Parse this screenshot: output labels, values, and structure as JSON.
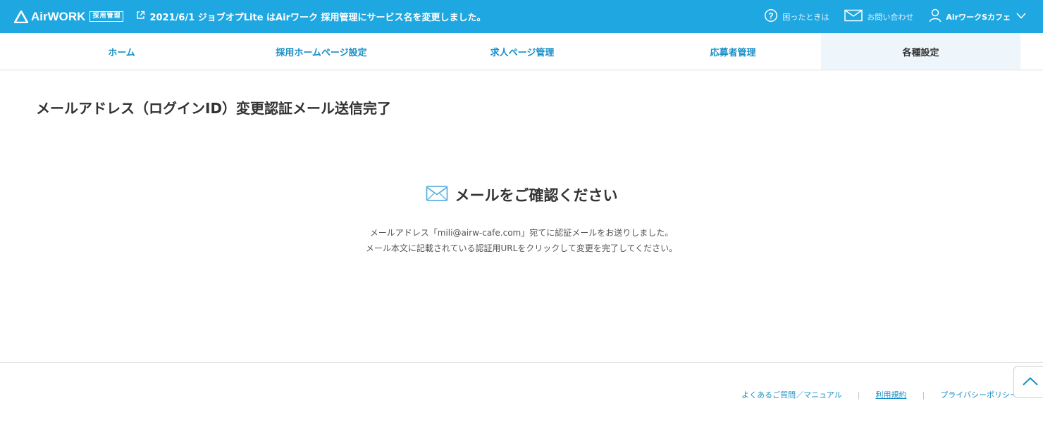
{
  "header": {
    "logo_text": "AirWORK",
    "logo_badge": "採用管理",
    "notice": "2021/6/1 ジョブオプLite はAirワーク 採用管理にサービス名を変更しました。",
    "help_label": "困ったときは",
    "contact_label": "お問い合わせ",
    "user_label": "AirワークSカフェ"
  },
  "nav": {
    "items": [
      {
        "label": "ホーム"
      },
      {
        "label": "採用ホームページ設定"
      },
      {
        "label": "求人ページ管理"
      },
      {
        "label": "応募者管理"
      },
      {
        "label": "各種設定"
      }
    ]
  },
  "main": {
    "title": "メールアドレス（ログインID）変更認証メール送信完了",
    "confirm_heading": "メールをご確認ください",
    "desc_line1": "メールアドレス「mili@airw-cafe.com」宛てに認証メールをお送りしました。",
    "desc_line2": "メール本文に記載されている認証用URLをクリックして変更を完了してください。"
  },
  "footer": {
    "faq": "よくあるご質問／マニュアル",
    "terms": "利用規約",
    "privacy": "プライバシーポリシー"
  },
  "colors": {
    "brand": "#1ea7e1",
    "link": "#1a8ec7"
  }
}
